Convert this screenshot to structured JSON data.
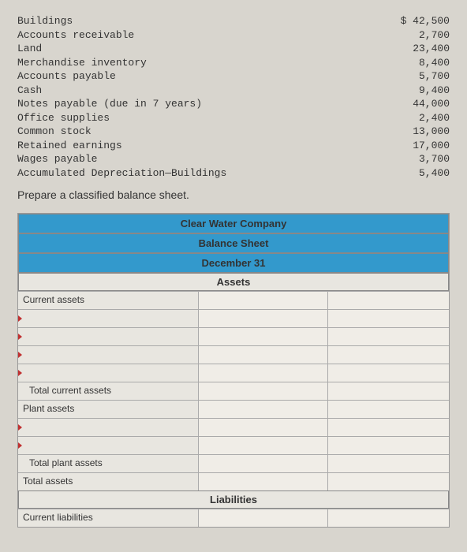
{
  "accounts": [
    {
      "label": "Buildings",
      "value": "$ 42,500"
    },
    {
      "label": "Accounts receivable",
      "value": "2,700"
    },
    {
      "label": "Land",
      "value": "23,400"
    },
    {
      "label": "Merchandise inventory",
      "value": "8,400"
    },
    {
      "label": "Accounts payable",
      "value": "5,700"
    },
    {
      "label": "Cash",
      "value": "9,400"
    },
    {
      "label": "Notes payable (due in 7 years)",
      "value": "44,000"
    },
    {
      "label": "Office supplies",
      "value": "2,400"
    },
    {
      "label": "Common stock",
      "value": "13,000"
    },
    {
      "label": "Retained earnings",
      "value": "17,000"
    },
    {
      "label": "Wages payable",
      "value": "3,700"
    },
    {
      "label": "Accumulated Depreciation—Buildings",
      "value": "5,400"
    }
  ],
  "instruction": "Prepare a classified balance sheet.",
  "sheet": {
    "company": "Clear Water Company",
    "title": "Balance Sheet",
    "date": "December 31",
    "section_assets": "Assets",
    "current_assets": "Current assets",
    "total_current_assets": "Total current assets",
    "plant_assets": "Plant assets",
    "total_plant_assets": "Total plant assets",
    "total_assets": "Total assets",
    "section_liabilities": "Liabilities",
    "current_liabilities": "Current liabilities"
  }
}
